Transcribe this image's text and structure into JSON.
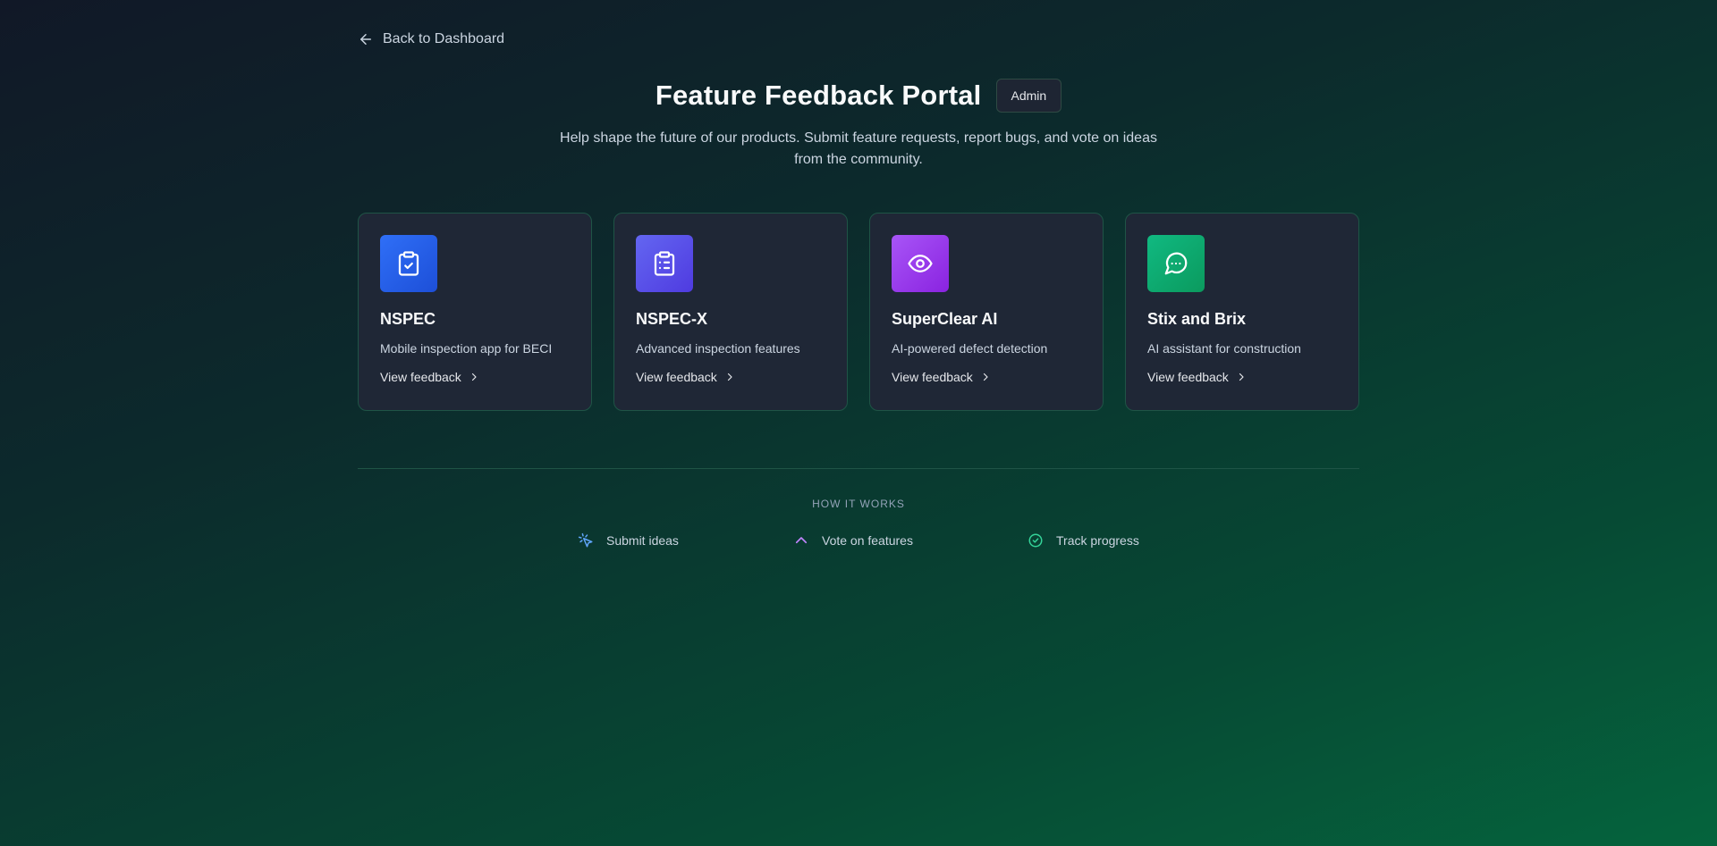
{
  "nav": {
    "back_label": "Back to Dashboard"
  },
  "header": {
    "title": "Feature Feedback Portal",
    "admin_label": "Admin",
    "subtitle": "Help shape the future of our products. Submit feature requests, report bugs, and vote on ideas from the community."
  },
  "products": [
    {
      "name": "NSPEC",
      "description": "Mobile inspection app for BECI",
      "link": "View feedback",
      "icon": "clipboard-check-icon",
      "color": "#2563eb"
    },
    {
      "name": "NSPEC-X",
      "description": "Advanced inspection features",
      "link": "View feedback",
      "icon": "clipboard-list-icon",
      "color": "#5b4ee8"
    },
    {
      "name": "SuperClear AI",
      "description": "AI-powered defect detection",
      "link": "View feedback",
      "icon": "eye-icon",
      "color": "#9b30e8"
    },
    {
      "name": "Stix and Brix",
      "description": "AI assistant for construction",
      "link": "View feedback",
      "icon": "message-circle-icon",
      "color": "#10b070"
    }
  ],
  "how_it_works": {
    "title": "HOW IT WORKS",
    "steps": [
      {
        "label": "Submit ideas",
        "icon": "pointer-click-icon",
        "color": "#60a5fa"
      },
      {
        "label": "Vote on features",
        "icon": "chevron-up-icon",
        "color": "#c084fc"
      },
      {
        "label": "Track progress",
        "icon": "check-circle-icon",
        "color": "#34d399"
      }
    ]
  }
}
